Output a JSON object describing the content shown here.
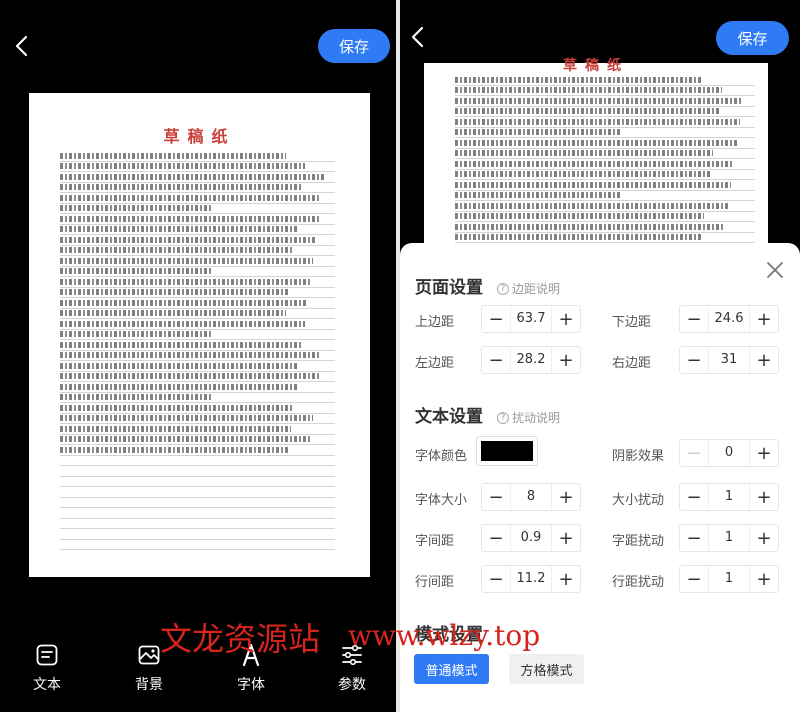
{
  "left": {
    "save_label": "保存",
    "paper_title": "草稿纸",
    "toolbar": [
      {
        "label": "文本",
        "icon": "text-icon"
      },
      {
        "label": "背景",
        "icon": "image-icon"
      },
      {
        "label": "字体",
        "icon": "font-icon"
      },
      {
        "label": "参数",
        "icon": "sliders-icon"
      }
    ]
  },
  "right": {
    "save_label": "保存",
    "paper_title": "草稿纸",
    "panel": {
      "page_settings": {
        "title": "页面设置",
        "hint": "边距说明",
        "top_margin": {
          "label": "上边距",
          "value": "63.7"
        },
        "bottom_margin": {
          "label": "下边距",
          "value": "24.6"
        },
        "left_margin": {
          "label": "左边距",
          "value": "28.2"
        },
        "right_margin": {
          "label": "右边距",
          "value": "31"
        }
      },
      "text_settings": {
        "title": "文本设置",
        "hint": "扰动说明",
        "font_color": {
          "label": "字体颜色",
          "color": "#000000"
        },
        "shadow": {
          "label": "阴影效果",
          "value": "0"
        },
        "font_size": {
          "label": "字体大小",
          "value": "8"
        },
        "size_jitter": {
          "label": "大小扰动",
          "value": "1"
        },
        "letter_spacing": {
          "label": "字间距",
          "value": "0.9"
        },
        "spacing_jitter": {
          "label": "字距扰动",
          "value": "1"
        },
        "line_spacing": {
          "label": "行间距",
          "value": "11.2"
        },
        "line_jitter": {
          "label": "行距扰动",
          "value": "1"
        }
      },
      "mode_settings": {
        "title": "模式设置",
        "normal_label": "普通模式",
        "grid_label": "方格模式"
      }
    }
  },
  "watermark": {
    "cn": "文龙资源站",
    "url": "www.wlzy.top"
  },
  "colors": {
    "accent": "#2f7bf5",
    "title_red": "#c9403a",
    "watermark_red": "#d7241d"
  }
}
